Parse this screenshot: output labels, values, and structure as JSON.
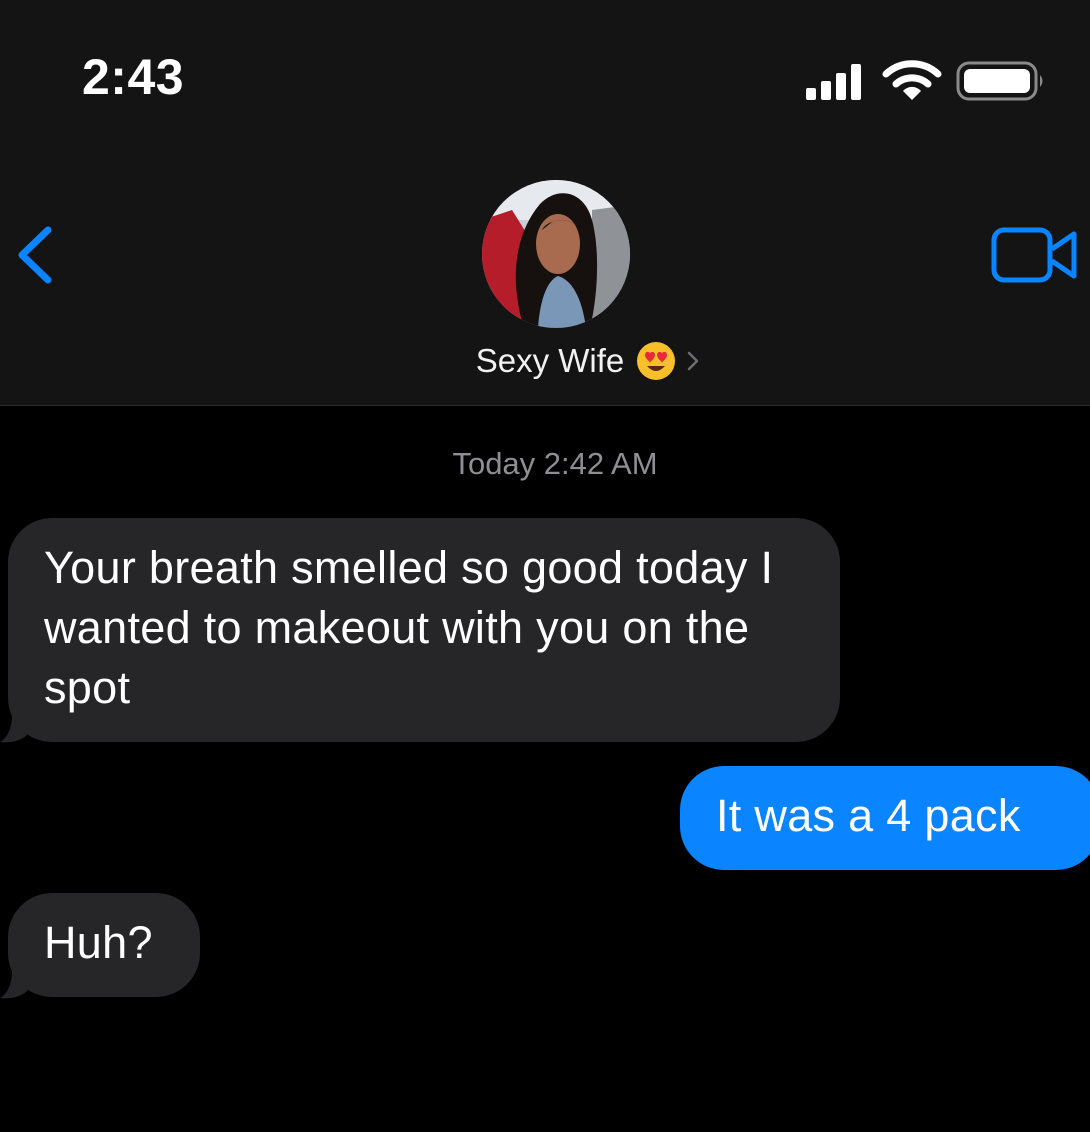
{
  "status_bar": {
    "time": "2:43",
    "signal_icon": "cellular-signal-icon",
    "wifi_icon": "wifi-icon",
    "battery_icon": "battery-icon"
  },
  "header": {
    "back_icon": "chevron-left-icon",
    "contact_name": "Sexy Wife",
    "contact_emoji": "heart-eyes-emoji",
    "chevron_icon": "chevron-right-icon",
    "video_icon": "video-camera-icon"
  },
  "conversation": {
    "timestamp": "Today 2:42 AM",
    "messages": [
      {
        "direction": "received",
        "text": "Your breath smelled so good today I wanted to makeout with you on the spot"
      },
      {
        "direction": "sent",
        "text": "It was a 4 pack"
      },
      {
        "direction": "received",
        "text": "Huh?"
      }
    ]
  },
  "colors": {
    "background": "#000000",
    "header_background": "#141414",
    "received_bubble": "#262628",
    "sent_bubble": "#0a84ff",
    "accent": "#0a84ff",
    "timestamp_text": "#8e8e93"
  }
}
